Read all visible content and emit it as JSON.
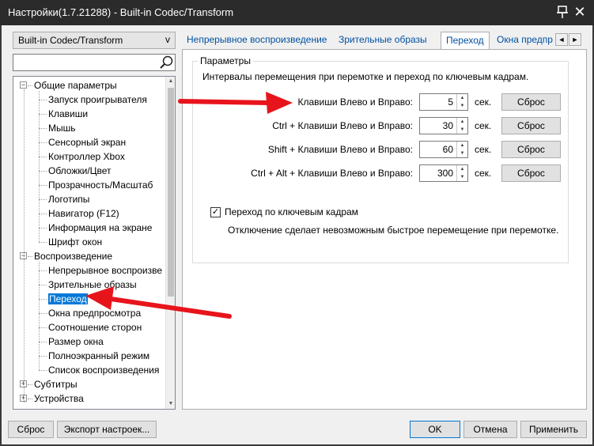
{
  "window": {
    "title": "Настройки(1.7.21288) - Built-in Codec/Transform",
    "close_glyph": "✕"
  },
  "sidebar": {
    "combo_value": "Built-in Codec/Transform",
    "combo_arrow": "v",
    "search_value": "",
    "tree": [
      {
        "label": "Общие параметры",
        "level": 0,
        "expander": "−"
      },
      {
        "label": "Запуск проигрывателя",
        "level": 1
      },
      {
        "label": "Клавиши",
        "level": 1
      },
      {
        "label": "Мышь",
        "level": 1
      },
      {
        "label": "Сенсорный экран",
        "level": 1
      },
      {
        "label": "Контроллер Xbox",
        "level": 1
      },
      {
        "label": "Обложки/Цвет",
        "level": 1
      },
      {
        "label": "Прозрачность/Масштаб",
        "level": 1
      },
      {
        "label": "Логотипы",
        "level": 1
      },
      {
        "label": "Навигатор (F12)",
        "level": 1
      },
      {
        "label": "Информация на экране",
        "level": 1
      },
      {
        "label": "Шрифт окон",
        "level": 1
      },
      {
        "label": "Воспроизведение",
        "level": 0,
        "expander": "−"
      },
      {
        "label": "Непрерывное воспроизве",
        "level": 1
      },
      {
        "label": "Зрительные образы",
        "level": 1
      },
      {
        "label": "Переход",
        "level": 1,
        "selected": true
      },
      {
        "label": "Окна предпросмотра",
        "level": 1
      },
      {
        "label": "Соотношение сторон",
        "level": 1
      },
      {
        "label": "Размер окна",
        "level": 1
      },
      {
        "label": "Полноэкранный режим",
        "level": 1
      },
      {
        "label": "Список воспроизведения",
        "level": 1
      },
      {
        "label": "Субтитры",
        "level": 0,
        "expander": "+"
      },
      {
        "label": "Устройства",
        "level": 0,
        "expander": "+"
      }
    ]
  },
  "tabs": {
    "items": [
      {
        "label": "Непрерывное воспроизведение"
      },
      {
        "label": "Зрительные образы"
      },
      {
        "label": "Переход",
        "active": true
      },
      {
        "label": "Окна предпр"
      }
    ],
    "nav_prev": "◄",
    "nav_next": "►"
  },
  "panel": {
    "group_title": "Параметры",
    "description": "Интервалы перемещения при перемотке и переход по ключевым кадрам.",
    "rows": [
      {
        "label": "Клавиши Влево и Вправо:",
        "value": "5",
        "unit": "сек.",
        "reset": "Сброс"
      },
      {
        "label": "Ctrl + Клавиши Влево и Вправо:",
        "value": "30",
        "unit": "сек.",
        "reset": "Сброс"
      },
      {
        "label": "Shift + Клавиши Влево и Вправо:",
        "value": "60",
        "unit": "сек.",
        "reset": "Сброс"
      },
      {
        "label": "Ctrl + Alt + Клавиши Влево и Вправо:",
        "value": "300",
        "unit": "сек.",
        "reset": "Сброс"
      }
    ],
    "keyframe_checkbox": {
      "label": "Переход по ключевым кадрам",
      "checked": true,
      "check_glyph": "✓"
    },
    "keyframe_note": "Отключение сделает невозможным быстрое перемещение при перемотке."
  },
  "footer": {
    "reset": "Сброс",
    "export": "Экспорт настроек...",
    "ok": "OK",
    "cancel": "Отмена",
    "apply": "Применить"
  },
  "colors": {
    "accent": "#0078d7",
    "annotation_arrow": "#e8141c"
  }
}
